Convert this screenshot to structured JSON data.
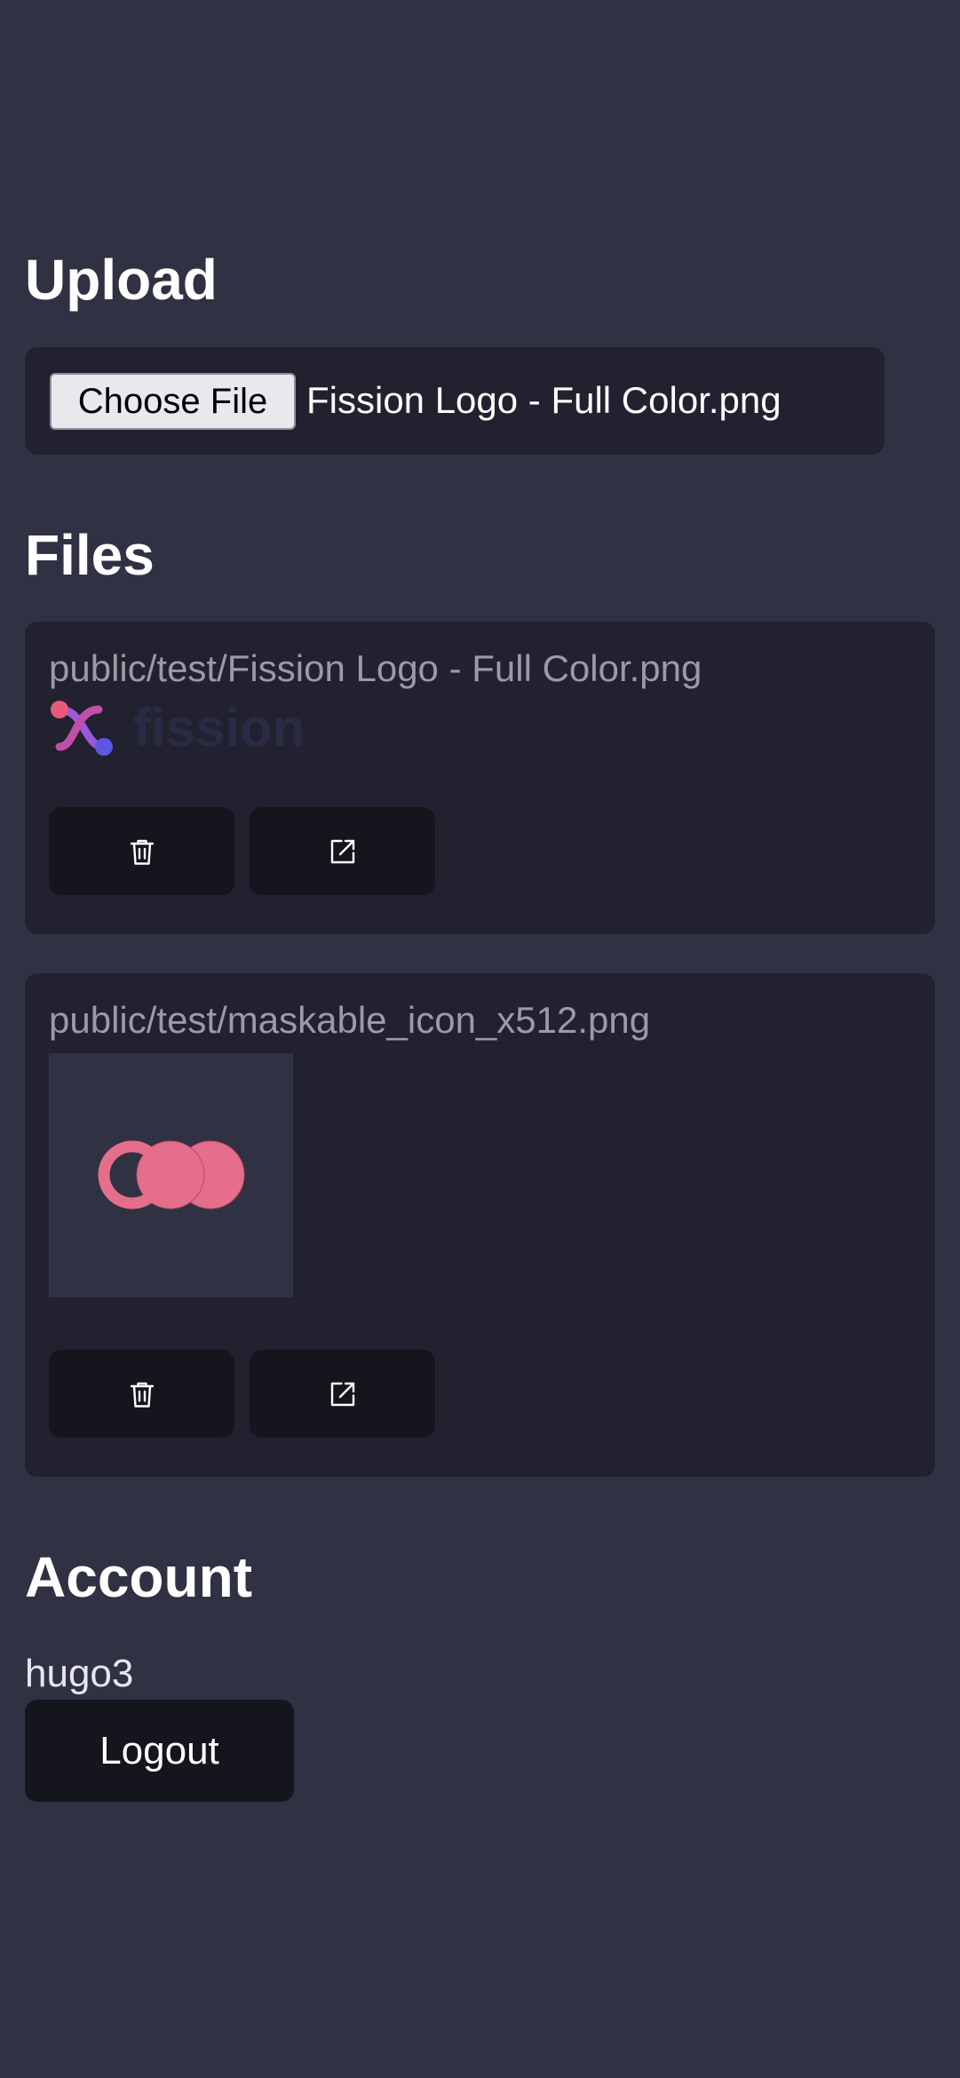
{
  "upload": {
    "heading": "Upload",
    "choose_button": "Choose File",
    "selected_file": "Fission Logo - Full Color.png"
  },
  "files": {
    "heading": "Files",
    "items": [
      {
        "path": "public/test/Fission Logo - Full Color.png",
        "preview_logo_text": "fission",
        "delete_icon": "trash-icon",
        "open_icon": "external-link-icon"
      },
      {
        "path": "public/test/maskable_icon_x512.png",
        "delete_icon": "trash-icon",
        "open_icon": "external-link-icon"
      }
    ]
  },
  "account": {
    "heading": "Account",
    "username": "hugo3",
    "logout_label": "Logout"
  },
  "colors": {
    "background": "#313144",
    "card": "#212130",
    "button": "#15151d",
    "accent_pink": "#e56e8a",
    "accent_purple": "#6b5ce7"
  }
}
